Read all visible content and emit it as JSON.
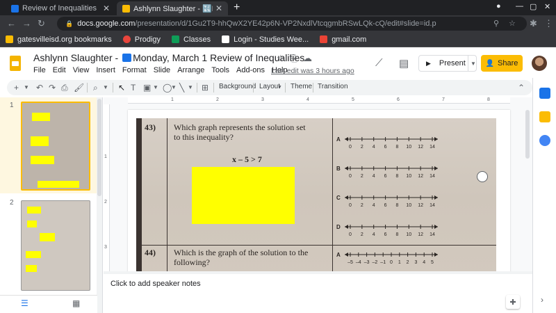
{
  "browser": {
    "tabs": [
      {
        "title": "Review of Inequalities",
        "icon": "calendar-tile-icon",
        "active": false
      },
      {
        "title": "Ashlynn Slaughter - 🔣Monday, M",
        "icon": "slides-icon",
        "active": true
      }
    ],
    "url_host": "docs.google.com",
    "url_path": "/presentation/d/1Gu2T9-hhQwX2YE42p6N-VP2NxdlVtcqgmbRSwLQk-cQ/edit#slide=id.p",
    "bookmarks": [
      {
        "label": "gatesvilleisd.org bookmarks",
        "icon": "folder-icon",
        "color": "#fbbc04"
      },
      {
        "label": "Prodigy",
        "icon": "prodigy-icon",
        "color": "#e8453c"
      },
      {
        "label": "Classes",
        "icon": "classroom-icon",
        "color": "#0f9d58"
      },
      {
        "label": "Login - Studies Wee...",
        "icon": "studies-weekly-icon",
        "color": "#ffffff"
      },
      {
        "label": "gmail.com",
        "icon": "gmail-icon",
        "color": "#ea4335"
      }
    ]
  },
  "app": {
    "title_prefix": "Ashlynn Slaughter - ",
    "title_rest": "Monday, March 1 Review of Inequalities",
    "menu": [
      "File",
      "Edit",
      "View",
      "Insert",
      "Format",
      "Slide",
      "Arrange",
      "Tools",
      "Add-ons",
      "Help"
    ],
    "last_edit": "Last edit was 3 hours ago",
    "present_label": "Present",
    "share_label": "Share",
    "accent": "#fbbc04"
  },
  "toolbar": {
    "background": "Background",
    "layout": "Layout",
    "theme": "Theme",
    "transition": "Transition"
  },
  "filmstrip": {
    "slides": [
      {
        "number": "1",
        "selected": true
      },
      {
        "number": "2",
        "selected": false
      }
    ]
  },
  "ruler": {
    "h_ticks": [
      "1",
      "2",
      "3",
      "4",
      "5",
      "6",
      "7",
      "8"
    ],
    "v_ticks": [
      "1",
      "2",
      "3"
    ]
  },
  "slide": {
    "q43_num": "43)",
    "q43_text_1": "Which graph represents the solution set",
    "q43_text_2": "to this inequality?",
    "q43_inequality": "x – 5 > 7",
    "choices": [
      {
        "letter": "A",
        "ticks": [
          "0",
          "2",
          "4",
          "6",
          "8",
          "10",
          "12",
          "14"
        ]
      },
      {
        "letter": "B",
        "ticks": [
          "0",
          "2",
          "4",
          "6",
          "8",
          "10",
          "12",
          "14"
        ]
      },
      {
        "letter": "C",
        "ticks": [
          "0",
          "2",
          "4",
          "6",
          "8",
          "10",
          "12",
          "14"
        ]
      },
      {
        "letter": "D",
        "ticks": [
          "0",
          "2",
          "4",
          "6",
          "8",
          "10",
          "12",
          "14"
        ]
      }
    ],
    "q44_num": "44)",
    "q44_text_1": "Which is the graph of the solution to the",
    "q44_text_2": "following?",
    "q44_choice_letter": "A",
    "q44_ticks": [
      "–5",
      "–4",
      "–3",
      "–2",
      "–1",
      "0",
      "1",
      "2",
      "3",
      "4",
      "5"
    ]
  },
  "notes": {
    "placeholder": "Click to add speaker notes"
  }
}
